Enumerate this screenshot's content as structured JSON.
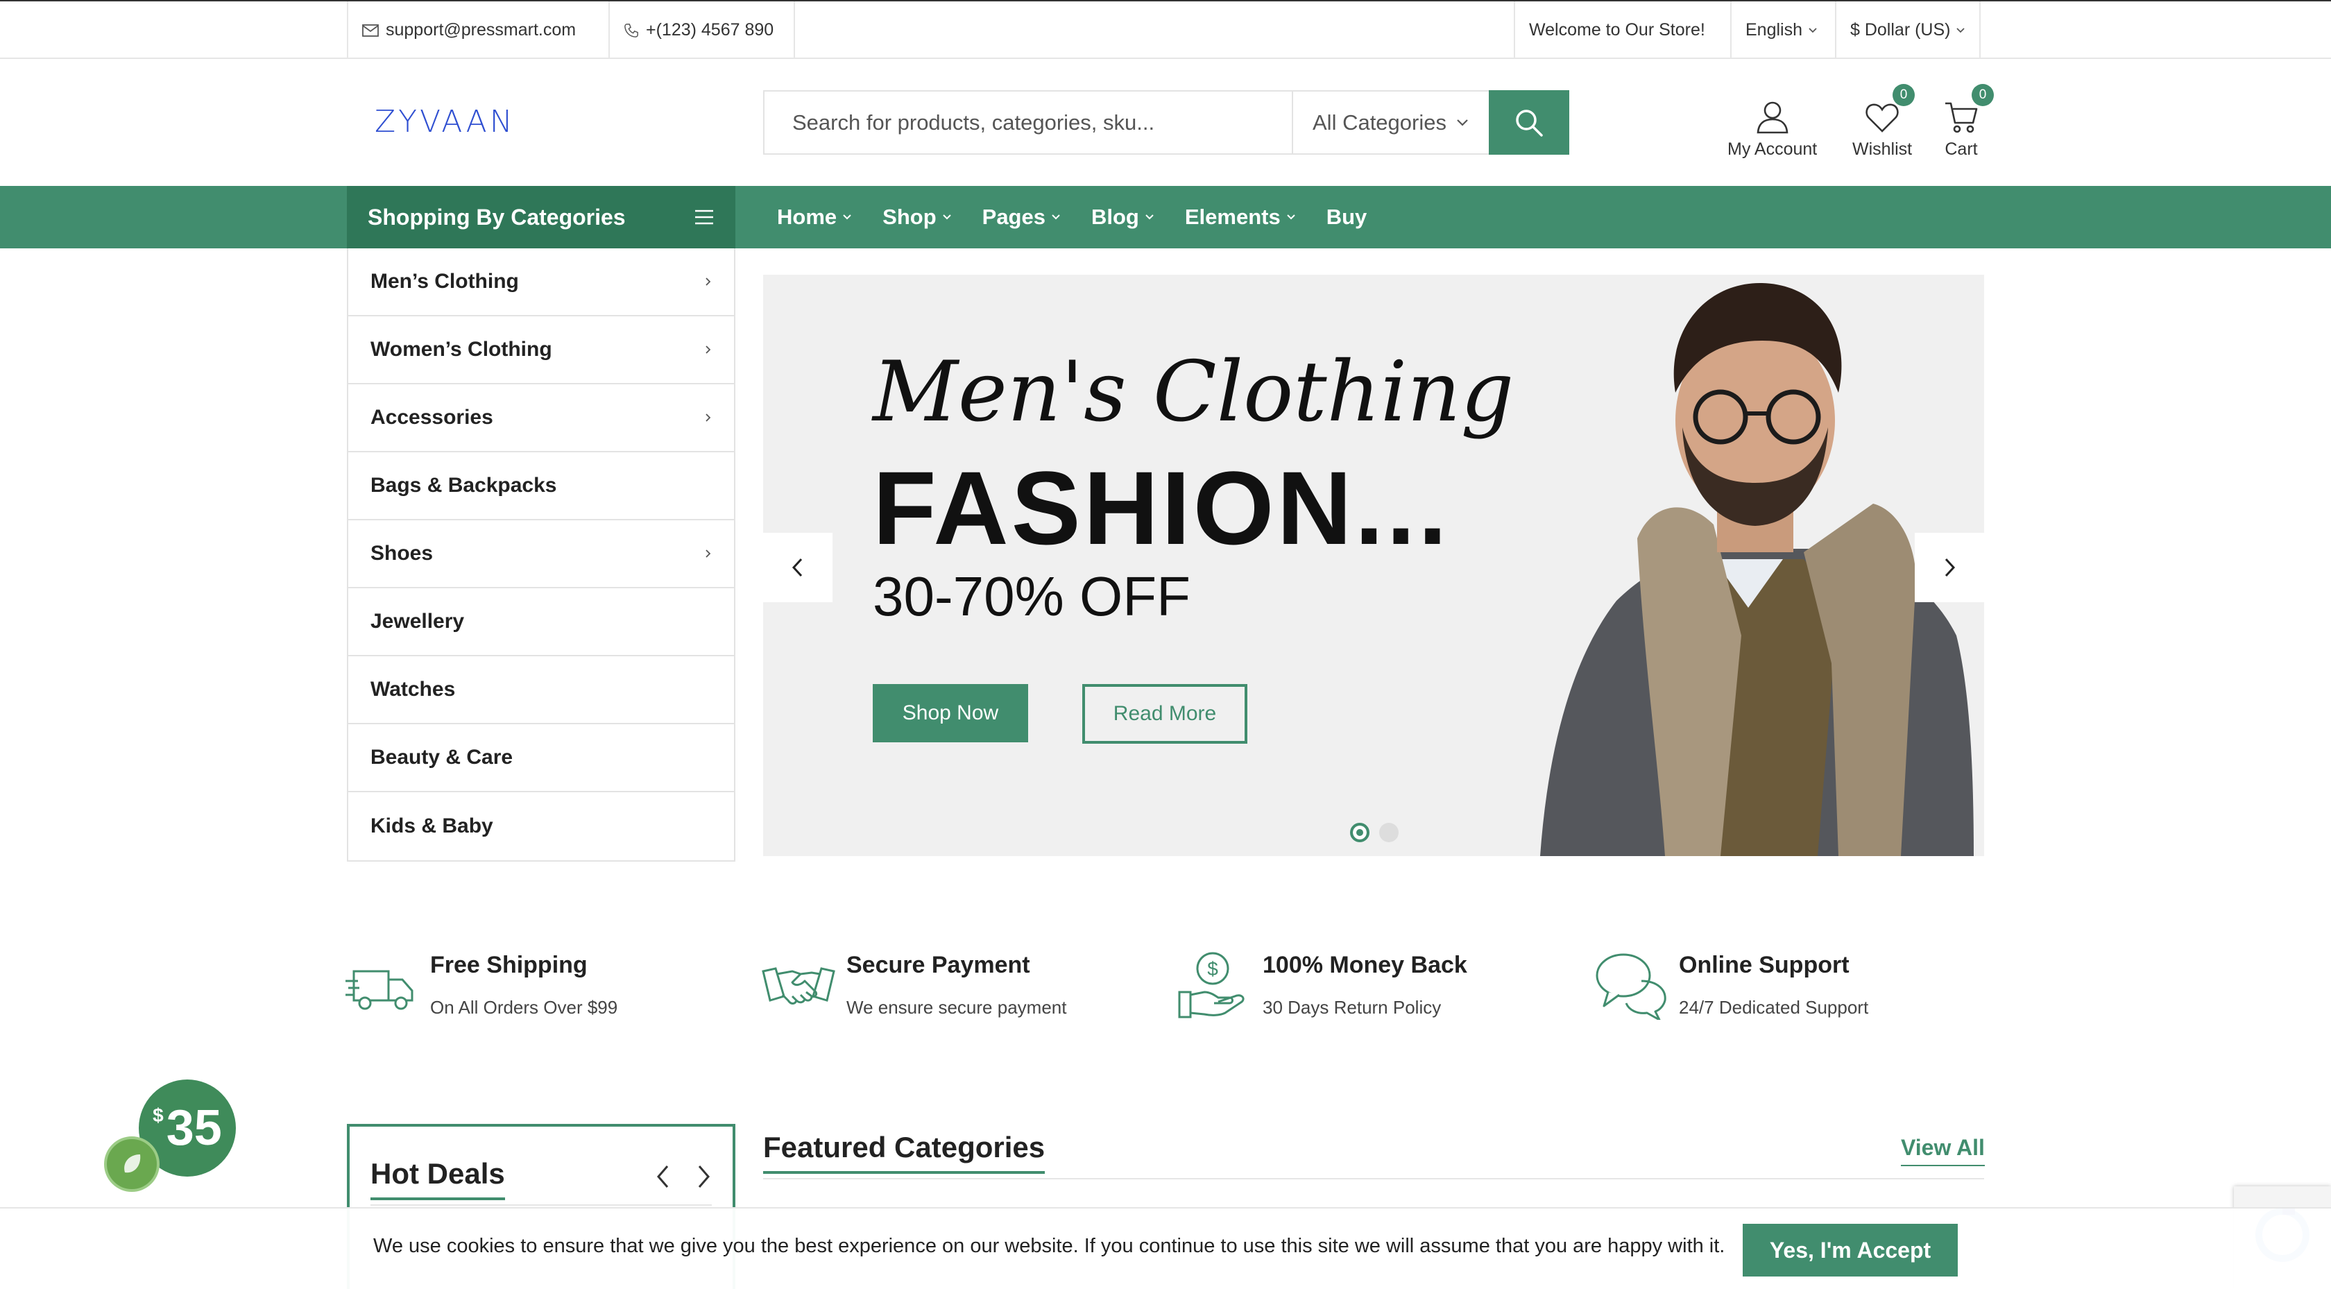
{
  "topbar": {
    "email": "support@pressmart.com",
    "phone": "+(123) 4567 890",
    "welcome": "Welcome to Our Store!",
    "language": "English",
    "currency": "$ Dollar (US)"
  },
  "header": {
    "logo": "ZYVAAN",
    "search_placeholder": "Search for products, categories, sku...",
    "category_select": "All Categories",
    "account_label": "My Account",
    "wishlist_label": "Wishlist",
    "wishlist_count": "0",
    "cart_label": "Cart",
    "cart_count": "0"
  },
  "nav": {
    "categories_title": "Shopping By Categories",
    "items": [
      {
        "label": "Home"
      },
      {
        "label": "Shop"
      },
      {
        "label": "Pages"
      },
      {
        "label": "Blog"
      },
      {
        "label": "Elements"
      },
      {
        "label": "Buy"
      }
    ]
  },
  "sidebar": {
    "items": [
      {
        "label": "Men’s Clothing",
        "has_sub": true
      },
      {
        "label": "Women’s Clothing",
        "has_sub": true
      },
      {
        "label": "Accessories",
        "has_sub": true
      },
      {
        "label": "Bags & Backpacks",
        "has_sub": false
      },
      {
        "label": "Shoes",
        "has_sub": true
      },
      {
        "label": "Jewellery",
        "has_sub": false
      },
      {
        "label": "Watches",
        "has_sub": false
      },
      {
        "label": "Beauty & Care",
        "has_sub": false
      },
      {
        "label": "Kids & Baby",
        "has_sub": false
      }
    ]
  },
  "hero": {
    "script_title": "Men's Clothing",
    "title": "FASHION...",
    "subtitle": "30-70% OFF",
    "primary_button": "Shop Now",
    "secondary_button": "Read More",
    "slides_total": 2,
    "active_slide": 1
  },
  "features": [
    {
      "icon": "truck-icon",
      "title": "Free Shipping",
      "subtitle": "On All Orders Over $99"
    },
    {
      "icon": "handshake-icon",
      "title": "Secure Payment",
      "subtitle": "We ensure secure payment"
    },
    {
      "icon": "money-back-icon",
      "title": "100% Money Back",
      "subtitle": "30 Days Return Policy"
    },
    {
      "icon": "chat-icon",
      "title": "Online Support",
      "subtitle": "24/7 Dedicated Support"
    }
  ],
  "promo": {
    "currency": "$",
    "amount": "35"
  },
  "sections": {
    "hot_deals": "Hot Deals",
    "featured_categories": "Featured Categories",
    "view_all": "View All"
  },
  "cookie": {
    "text": "We use cookies to ensure that we give you the best experience on our website. If you continue to use this site we will assume that you are happy with it.",
    "accept": "Yes, I'm Accept"
  },
  "colors": {
    "accent": "#418d6e",
    "accent_dark": "#2f7758",
    "logo": "#2f4fd1"
  }
}
